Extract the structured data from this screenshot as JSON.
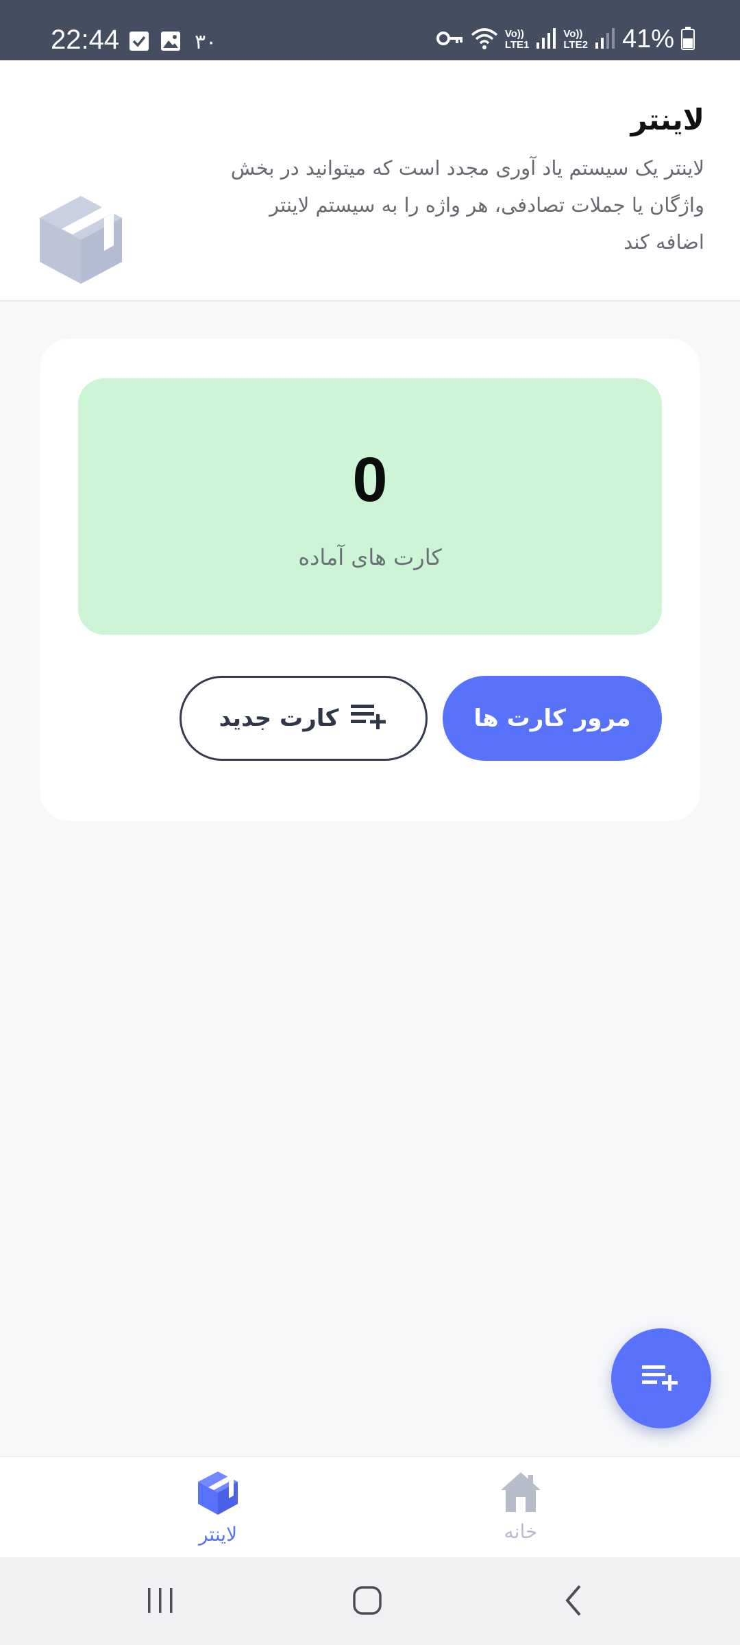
{
  "status_bar": {
    "time": "22:44",
    "badge_text": "۳۰",
    "lte1": "LTE1",
    "lte2": "LTE2",
    "volte": "Vo))",
    "battery_percent": "41%",
    "icons": [
      "checkbox-icon",
      "image-icon",
      "key-icon",
      "wifi-icon",
      "signal-icon",
      "battery-icon"
    ]
  },
  "header": {
    "title": "لاینتر",
    "description": "لاینتر یک سیستم یاد آوری مجدد است که میتوانید در بخش واژگان یا جملات تصادفی، هر واژه را به سیستم لاینتر اضافه کند",
    "logo_icon": "box-icon"
  },
  "stats": {
    "count": "0",
    "label": "کارت های آماده"
  },
  "buttons": {
    "review_label": "مرور کارت ها",
    "new_card_label": "کارت جدید"
  },
  "fab": {
    "icon": "playlist-add-icon"
  },
  "bottom_nav": {
    "items": [
      {
        "label": "لاینتر",
        "icon": "box-icon",
        "active": true
      },
      {
        "label": "خانه",
        "icon": "home-icon",
        "active": false
      }
    ]
  },
  "colors": {
    "accent": "#5872fb",
    "status_bar": "#454e61",
    "stats_bg": "#cdf4d5",
    "inactive": "#b7bccb"
  }
}
